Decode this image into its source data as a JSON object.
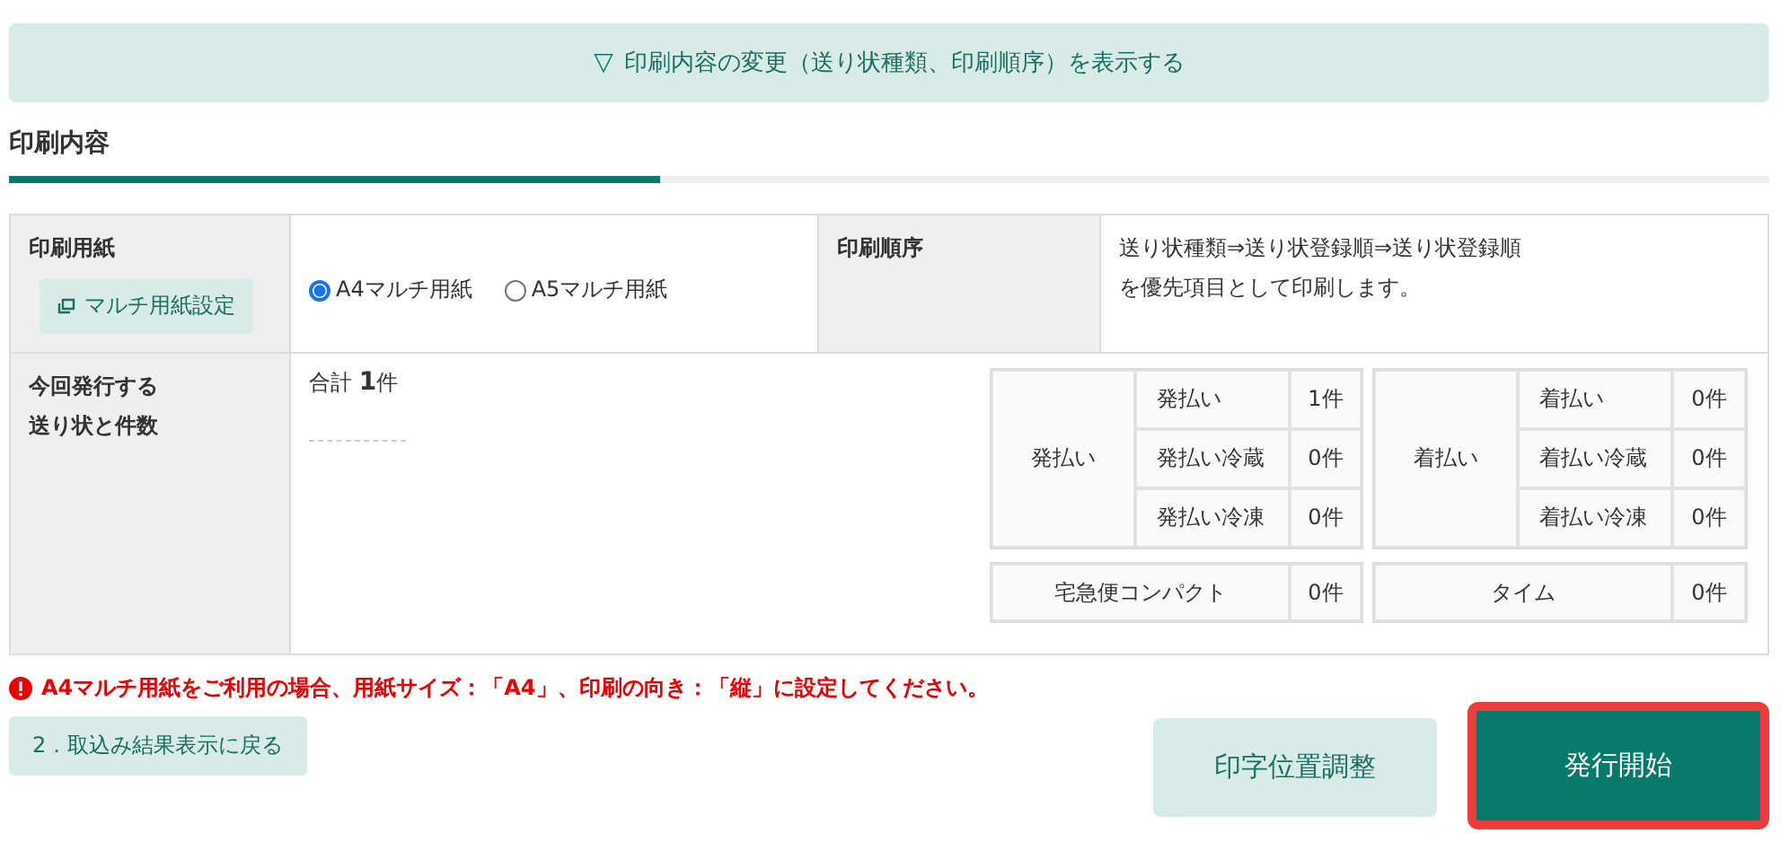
{
  "toggle_bar": {
    "icon": "▽",
    "label": "印刷内容の変更（送り状種類、印刷順序）を表示する"
  },
  "section_title": "印刷内容",
  "paper": {
    "label": "印刷用紙",
    "settings_button": "マルチ用紙設定",
    "options": [
      {
        "label": "A4マルチ用紙",
        "selected": true
      },
      {
        "label": "A5マルチ用紙",
        "selected": false
      }
    ]
  },
  "print_order": {
    "label": "印刷順序",
    "lines": [
      "送り状種類⇒送り状登録順⇒送り状登録順",
      "を優先項目として印刷します。"
    ]
  },
  "counts": {
    "label_lines": [
      "今回発行する",
      "送り状と件数"
    ],
    "total": "合計 **1**件",
    "groups": [
      {
        "name": "発払い",
        "rows": [
          {
            "name": "発払い",
            "count": "1件"
          },
          {
            "name": "発払い冷蔵",
            "count": "0件"
          },
          {
            "name": "発払い冷凍",
            "count": "0件"
          }
        ]
      },
      {
        "name": "着払い",
        "rows": [
          {
            "name": "着払い",
            "count": "0件"
          },
          {
            "name": "着払い冷蔵",
            "count": "0件"
          },
          {
            "name": "着払い冷凍",
            "count": "0件"
          }
        ]
      }
    ],
    "singles": [
      {
        "name": "宅急便コンパクト",
        "count": "0件"
      },
      {
        "name": "タイム",
        "count": "0件"
      }
    ]
  },
  "warning": "A4マルチ用紙をご利用の場合、用紙サイズ：「A4」、印刷の向き：「縦」に設定してください。",
  "back_button": "2．取込み結果表示に戻る",
  "adjust_button": "印字位置調整",
  "issue_button": {
    "label": "発行開始",
    "highlighted": true
  }
}
